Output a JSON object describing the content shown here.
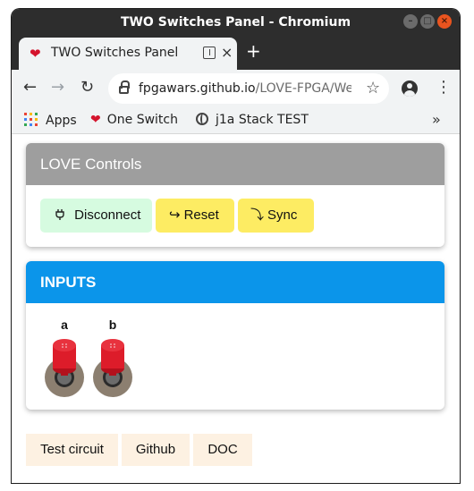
{
  "window": {
    "title": "TWO Switches Panel - Chromium",
    "minimize_glyph": "–",
    "maximize_glyph": "□",
    "close_glyph": "×"
  },
  "tabs": [
    {
      "title": "TWO Switches Panel",
      "favicon": "heart-icon",
      "close_glyph": "×"
    }
  ],
  "newtab_glyph": "+",
  "toolbar": {
    "back_glyph": "←",
    "forward_glyph": "→",
    "reload_glyph": "↻",
    "url_host": "fpgawars.github.io",
    "url_path": "/LOVE-FPGA/We...",
    "star_glyph": "☆",
    "menu_glyph": "⋮"
  },
  "bookmarks": {
    "items": [
      {
        "label": "Apps",
        "icon": "apps-grid-icon"
      },
      {
        "label": "One Switch",
        "icon": "heart-icon"
      },
      {
        "label": "j1a Stack TEST",
        "icon": "globe-icon"
      }
    ],
    "overflow_glyph": "»"
  },
  "love_controls": {
    "title": "LOVE Controls",
    "buttons": [
      {
        "label": "Disconnect",
        "icon": "plug-icon",
        "glyph": "⏻",
        "color": "#d6fbe0"
      },
      {
        "label": "Reset",
        "icon": "return-arrow-icon",
        "glyph": "↪",
        "color": "#fdec63"
      },
      {
        "label": "Sync",
        "icon": "sync-arrow-icon",
        "glyph": "⤵",
        "color": "#fdec63"
      }
    ]
  },
  "inputs": {
    "title": "INPUTS",
    "switches": [
      {
        "label": "a"
      },
      {
        "label": "b"
      }
    ]
  },
  "links": [
    {
      "label": "Test circuit"
    },
    {
      "label": "Github"
    },
    {
      "label": "DOC"
    }
  ],
  "colors": {
    "love_header": "#9e9e9e",
    "inputs_header": "#0b95ea",
    "link_bg": "#fdf1e2"
  }
}
